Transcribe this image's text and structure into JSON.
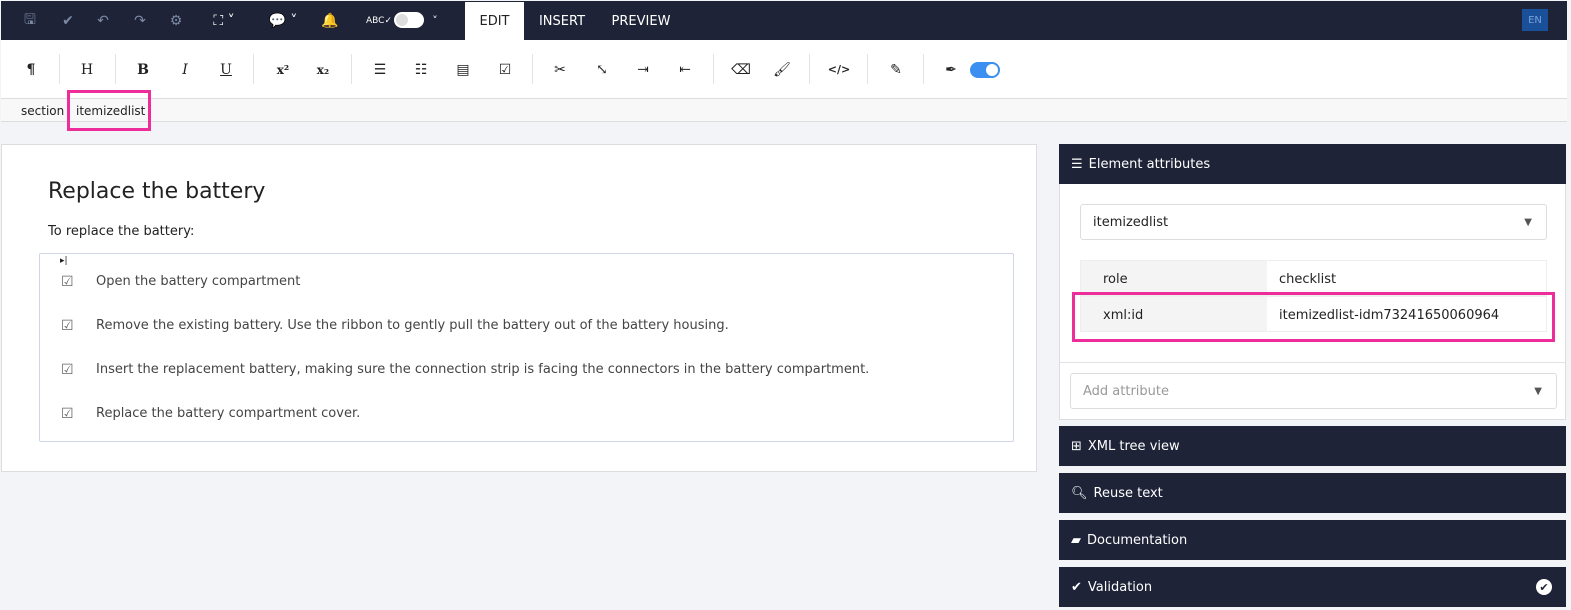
{
  "topbar": {
    "icons": [
      "save-icon",
      "check-icon",
      "undo-icon",
      "redo-icon",
      "gear-icon",
      "fullscreen-icon",
      "comments-icon",
      "bell-icon",
      "spellcheck-icon"
    ],
    "tabs": [
      {
        "label": "EDIT",
        "active": true
      },
      {
        "label": "INSERT"
      },
      {
        "label": "PREVIEW"
      }
    ],
    "language": "EN"
  },
  "toolbar": {
    "paragraph": "¶",
    "heading": "H",
    "bold": "B",
    "italic": "I",
    "underline": "U",
    "superscript": "x²",
    "subscript": "x₂",
    "code": "</>"
  },
  "breadcrumb": [
    "section",
    "itemizedlist"
  ],
  "document": {
    "title": "Replace the battery",
    "intro": "To replace the battery:",
    "checkbox": "☑",
    "items": [
      "Open the battery compartment",
      "Remove the existing battery. Use the ribbon to gently pull the battery out of the battery housing.",
      "Insert the replacement battery, making sure the connection strip is facing the connectors in the battery compartment.",
      "Replace the battery compartment cover."
    ]
  },
  "panel": {
    "element_attributes": "Element attributes",
    "element_select": "itemizedlist",
    "attributes": [
      {
        "name": "role",
        "value": "checklist"
      },
      {
        "name": "xml:id",
        "value": "itemizedlist-idm73241650060964"
      }
    ],
    "add_attribute_placeholder": "Add attribute",
    "sections": [
      "XML tree view",
      "Reuse text",
      "Documentation",
      "Validation"
    ]
  },
  "colors": {
    "navy": "#1e2337",
    "highlight": "#ec2d9a",
    "toggle": "#3b8ff0"
  }
}
